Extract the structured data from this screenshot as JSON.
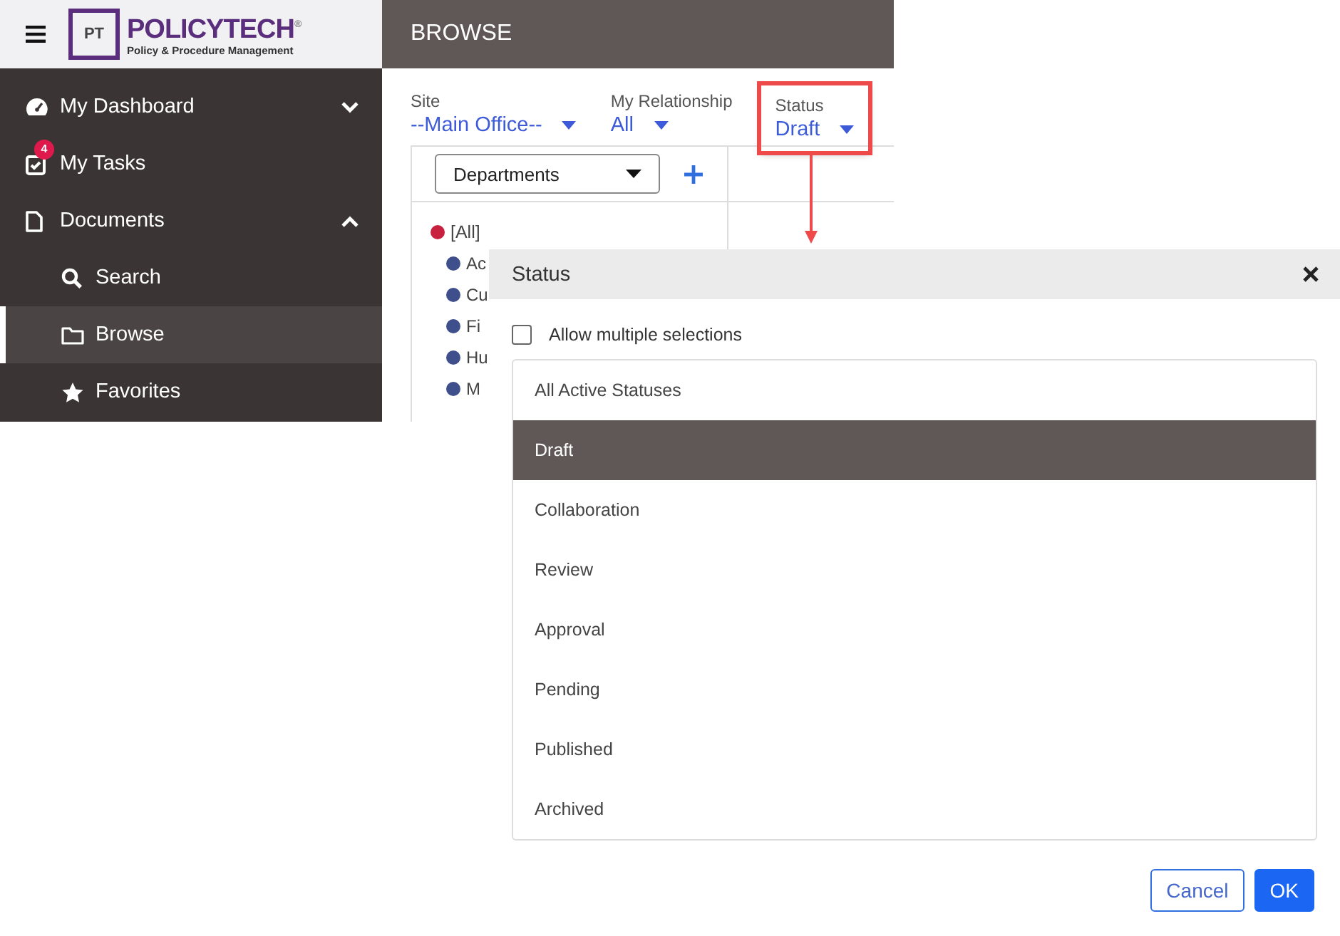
{
  "sidebar": {
    "logo": {
      "mark": "PT",
      "name": "POLICYTECH$^{®}$",
      "tagline": "Policy & Procedure Management"
    },
    "items": [
      {
        "label": "My Dashboard",
        "selected": false,
        "expanded": false
      },
      {
        "label": "My Tasks",
        "selected": false,
        "badge": "4"
      },
      {
        "label": "Documents",
        "selected": false,
        "expanded": true,
        "children": [
          {
            "label": "Search",
            "selected": false
          },
          {
            "label": "Browse",
            "selected": true
          },
          {
            "label": "Favorites",
            "selected": false
          }
        ]
      }
    ]
  },
  "header": {
    "title": "BROWSE"
  },
  "filters": [
    {
      "label": "Site",
      "value": "--Main Office--",
      "highlighted": false
    },
    {
      "label": "My Relationship",
      "value": "All",
      "highlighted": false
    },
    {
      "label": "Status",
      "value": "Draft",
      "highlighted": true
    }
  ],
  "tree": {
    "dropdown": "Departments",
    "nodes": [
      {
        "label": "[All]",
        "color": "#c8203f",
        "children": [
          {
            "label": "Ac",
            "color": "#3e4f8c"
          },
          {
            "label": "Cu",
            "color": "#3e4f8c"
          },
          {
            "label": "Fi",
            "color": "#3e4f8c"
          },
          {
            "label": "Hu",
            "color": "#3e4f8c"
          },
          {
            "label": "M",
            "color": "#3e4f8c"
          }
        ]
      }
    ]
  },
  "dialog": {
    "title": "Status",
    "allow_multiple": {
      "label": "Allow multiple selections",
      "checked": false
    },
    "options": [
      {
        "label": "All Active Statuses",
        "selected": false
      },
      {
        "label": "Draft",
        "selected": true
      },
      {
        "label": "Collaboration",
        "selected": false
      },
      {
        "label": "Review",
        "selected": false
      },
      {
        "label": "Approval",
        "selected": false
      },
      {
        "label": "Pending",
        "selected": false
      },
      {
        "label": "Published",
        "selected": false
      },
      {
        "label": "Archived",
        "selected": false
      }
    ],
    "buttons": [
      {
        "label": "Cancel",
        "kind": "secondary"
      },
      {
        "label": "OK",
        "kind": "primary"
      }
    ]
  }
}
